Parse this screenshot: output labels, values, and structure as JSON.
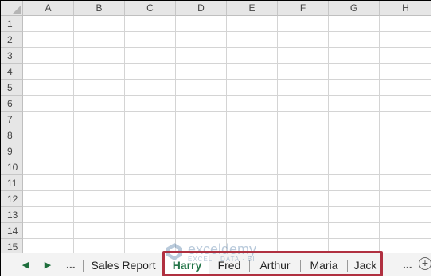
{
  "columns": [
    "A",
    "B",
    "C",
    "D",
    "E",
    "F",
    "G",
    "H"
  ],
  "rows": [
    "1",
    "2",
    "3",
    "4",
    "5",
    "6",
    "7",
    "8",
    "9",
    "10",
    "11",
    "12",
    "13",
    "14",
    "15"
  ],
  "sheet_nav": {
    "prev_label": "◀",
    "next_label": "▶",
    "more_left": "...",
    "more_right": "..."
  },
  "sheets": [
    {
      "name": "Sales Report",
      "active": false
    },
    {
      "name": "Harry",
      "active": true
    },
    {
      "name": "Fred",
      "active": false
    },
    {
      "name": "Arthur",
      "active": false
    },
    {
      "name": "Maria",
      "active": false
    },
    {
      "name": "Jack",
      "active": false
    }
  ],
  "add_sheet_label": "+",
  "watermark": {
    "name": "exceldemy",
    "tagline": "EXCEL · DATA · BI"
  },
  "colors": {
    "active_tab": "#217346",
    "highlight_box": "#b03040"
  }
}
